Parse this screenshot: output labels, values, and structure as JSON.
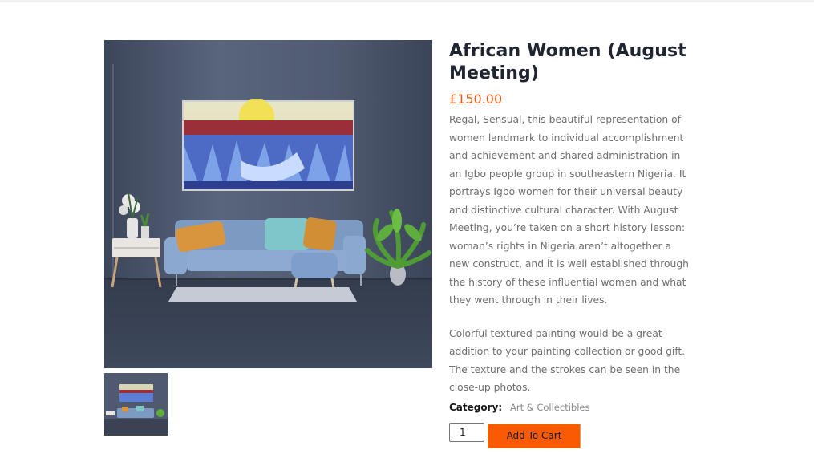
{
  "product": {
    "title": "African Women (August Meeting)",
    "price": "£150.00",
    "description": [
      "Regal, Sensual, this beautiful representation of women landmark to individual accomplishment and achievement and shared administration in an Igbo people group in southeastern Nigeria. It portrays Igbo women for their universal beauty and distinctive cultural character. With August Meeting, you’re taken on a short history lesson: woman’s rights in Nigeria aren’t altogether a new construct, and it is well established through the history of these influential women and what they went through in their lives.",
      "Colorful textured painting would be a great addition to your painting collection or good gift. The texture and the strokes can be seen in the close-up photos."
    ],
    "category_label": "Category:",
    "category_value": "Art & Collectibles",
    "quantity": "1",
    "add_to_cart_label": "Add To Cart"
  },
  "colors": {
    "price": "#e65c14",
    "button": "#fb5a05"
  },
  "icons": {
    "main_image": "painting-room-photo",
    "thumbnail": "painting-room-thumbnail"
  }
}
